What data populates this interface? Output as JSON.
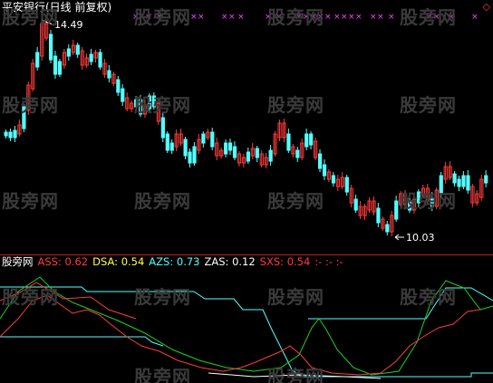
{
  "title": "平安银行(日线 前复权)",
  "watermark": "股旁网",
  "price_chart": {
    "max_label": "14.49",
    "min_label": "10.03",
    "up_color": "#ff3b3b",
    "down_color": "#54ffff",
    "marker_color": "#ff40ff"
  },
  "indicator": {
    "name": "股旁网",
    "values": [
      {
        "label": "ASS:",
        "value": "0.62",
        "color": "#ff3b3b"
      },
      {
        "label": "DSA:",
        "value": "0.54",
        "color": "#ffff54"
      },
      {
        "label": "AZS:",
        "value": "0.73",
        "color": "#54ffff"
      },
      {
        "label": "ZAS:",
        "value": "0.12",
        "color": "#ffffff"
      },
      {
        "label": "SXS:",
        "value": "0.54",
        "color": "#ff3b3b"
      }
    ],
    "dashes": ":- :- :-",
    "line_colors": {
      "cyan": "#54ffff",
      "green": "#20d020",
      "red": "#ff3b3b",
      "white": "#ffffff"
    }
  },
  "icons": {
    "corner": "diamond-icon"
  }
}
